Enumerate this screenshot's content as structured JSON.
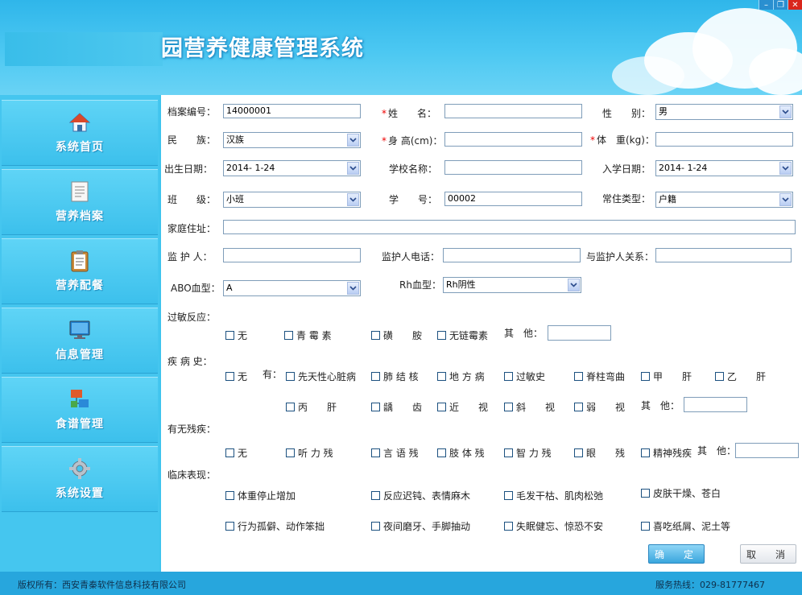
{
  "app": {
    "title": "园营养健康管理系统"
  },
  "window_controls": {
    "minimize": "–",
    "restore": "❐",
    "close": "✕"
  },
  "sidebar": {
    "items": [
      {
        "label": "系统首页",
        "icon": "home-icon"
      },
      {
        "label": "营养档案",
        "icon": "document-icon"
      },
      {
        "label": "营养配餐",
        "icon": "clipboard-icon"
      },
      {
        "label": "信息管理",
        "icon": "monitor-icon"
      },
      {
        "label": "食谱管理",
        "icon": "network-icon"
      },
      {
        "label": "系统设置",
        "icon": "gear-icon"
      }
    ]
  },
  "form": {
    "record_no": {
      "label": "档案编号：",
      "value": "14000001"
    },
    "name": {
      "label": "姓　　名：",
      "value": ""
    },
    "gender": {
      "label": "性　　别：",
      "value": "男"
    },
    "ethnicity": {
      "label": "民　　族：",
      "value": "汉族"
    },
    "height": {
      "label": "身 高(cm)：",
      "value": ""
    },
    "weight": {
      "label": "体　重(kg)：",
      "value": ""
    },
    "birth_date": {
      "label": "出生日期：",
      "value": "2014- 1-24"
    },
    "school": {
      "label": "学校名称：",
      "value": ""
    },
    "enroll_date": {
      "label": "入学日期：",
      "value": "2014- 1-24"
    },
    "class": {
      "label": "班　　级：",
      "value": "小班"
    },
    "student_no": {
      "label": "学　　号：",
      "value": "00002"
    },
    "residence": {
      "label": "常住类型：",
      "value": "户籍"
    },
    "address": {
      "label": "家庭住址：",
      "value": ""
    },
    "guardian": {
      "label": "监 护 人：",
      "value": ""
    },
    "guardian_phone": {
      "label": "监护人电话：",
      "value": ""
    },
    "guardian_relation": {
      "label": "与监护人关系：",
      "value": ""
    },
    "abo": {
      "label": "ABO血型：",
      "value": "A"
    },
    "rh": {
      "label": "Rh血型：",
      "value": "Rh阴性"
    },
    "allergy": {
      "label": "过敏反应：",
      "options": [
        "无",
        "青 霉 素",
        "磺　　胺",
        "无链霉素"
      ],
      "other_label": "其　他："
    },
    "disease": {
      "label": "疾 病 史：",
      "none": "无",
      "has_label": "有：",
      "row1": [
        "先天性心脏病",
        "肺 结 核",
        "地 方 病",
        "过敏史",
        "脊柱弯曲",
        "甲　　肝",
        "乙　　肝"
      ],
      "row2": [
        "丙　　肝",
        "龋　　齿",
        "近　　视",
        "斜　　视",
        "弱　　视"
      ],
      "other_label": "其　他："
    },
    "disability": {
      "label": "有无残疾：",
      "options": [
        "无",
        "听 力 残",
        "言 语 残",
        "肢 体 残",
        "智 力 残",
        "眼　　残",
        "精神残疾"
      ],
      "other_label": "其　他："
    },
    "clinical": {
      "label": "临床表现：",
      "row1": [
        "体重停止增加",
        "反应迟钝、表情麻木",
        "毛发干枯、肌肉松弛",
        "皮肤干燥、苍白"
      ],
      "row2": [
        "行为孤僻、动作笨拙",
        "夜间磨牙、手脚抽动",
        "失眠健忘、惊恐不安",
        "喜吃纸屑、泥土等"
      ]
    },
    "confirm_label": "确　定",
    "cancel_label": "取　消"
  },
  "footer": {
    "copyright": "版权所有：西安青秦软件信息科技有限公司",
    "hotline": "服务热线：029-81777467"
  },
  "colors": {
    "header": "#2fb6ea",
    "sidebar": "#45c6ef",
    "footer": "#27a6dd",
    "required": "#ee0000"
  }
}
